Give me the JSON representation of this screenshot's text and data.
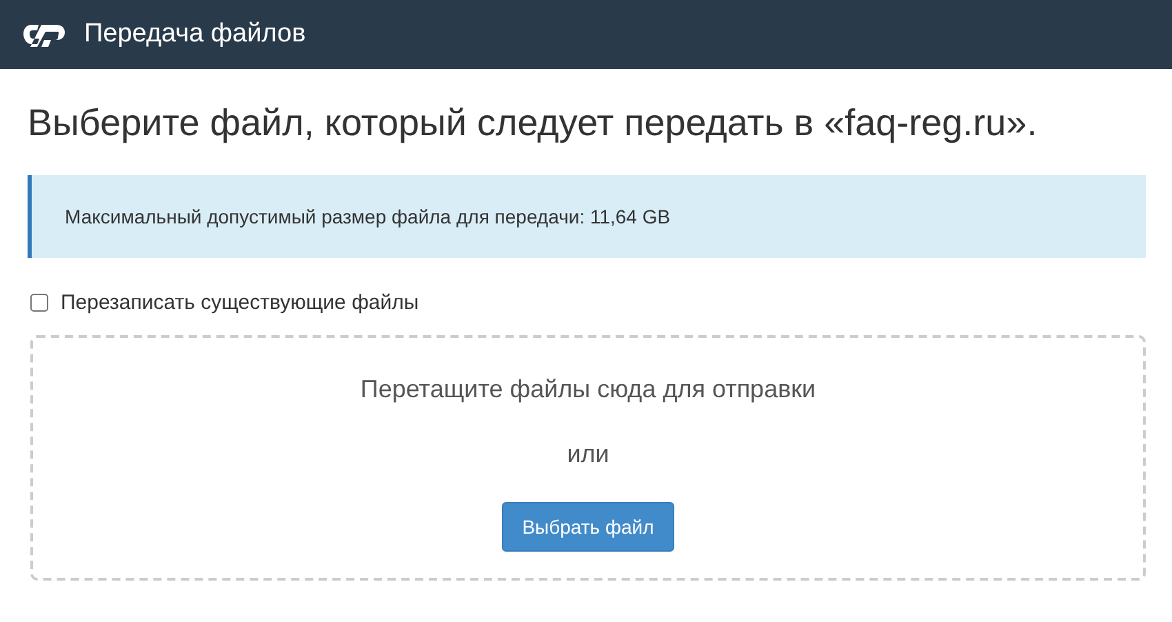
{
  "header": {
    "title": "Передача файлов"
  },
  "heading": "Выберите файл, который следует передать в «faq-reg.ru».",
  "info": "Максимальный допустимый размер файла для передачи: 11,64 GB",
  "overwrite": {
    "label": "Перезаписать существующие файлы",
    "checked": false
  },
  "dropzone": {
    "prompt": "Перетащите файлы сюда для отправки",
    "or": "или",
    "button": "Выбрать файл"
  }
}
